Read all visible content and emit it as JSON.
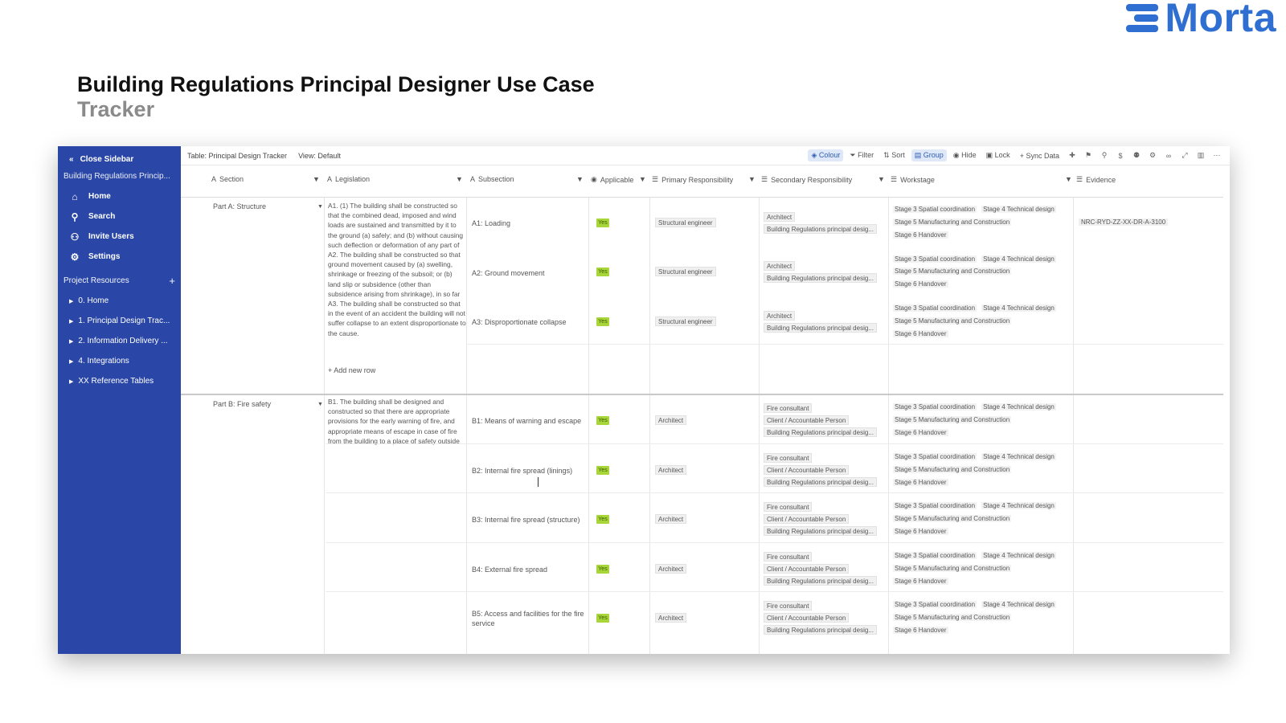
{
  "logo": {
    "text": "Morta",
    "color": "#2f6fd1"
  },
  "title": "Building Regulations Principal Designer Use Case",
  "subtitle": "Tracker",
  "sidebar": {
    "close_label": "Close Sidebar",
    "project_name": "Building Regulations Princip...",
    "nav": [
      {
        "label": "Home",
        "icon": "home-icon"
      },
      {
        "label": "Search",
        "icon": "search-icon"
      },
      {
        "label": "Invite Users",
        "icon": "users-icon"
      },
      {
        "label": "Settings",
        "icon": "gear-icon"
      }
    ],
    "resources_label": "Project Resources",
    "resources": [
      "0. Home",
      "1. Principal Design Trac...",
      "2. Information Delivery ...",
      "4. Integrations",
      "XX Reference Tables"
    ],
    "bg_color": "#2a47a8"
  },
  "toolbar": {
    "table_label": "Table: Principal Design Tracker",
    "view_label": "View: Default",
    "buttons": [
      "Colour",
      "Filter",
      "Sort",
      "Group",
      "Hide",
      "Lock",
      "Sync Data"
    ]
  },
  "columns": [
    "Section",
    "Legislation",
    "Subsection",
    "Applicable",
    "Primary Responsibility",
    "Secondary Responsibility",
    "Workstage",
    "Evidence"
  ],
  "groups": [
    {
      "section": "Part A: Structure",
      "legislation": "A1. (1) The building shall be constructed so that the combined dead, imposed and wind loads are sustained and transmitted by it to the ground (a) safely; and (b) without causing such deflection or deformation of any part of A2. The building shall be constructed so that ground movement caused by (a) swelling, shrinkage or freezing of the subsoil; or (b) land slip or subsidence (other than subsidence arising from shrinkage), in so far A3. The building shall be constructed so that in the event of an accident the building will not suffer collapse to an extent disproportionate to the cause.",
      "add_row": "+ Add new row",
      "rows": [
        {
          "subsection": "A1: Loading",
          "applicable": "Yes",
          "primary": "Structural engineer",
          "secondary": [
            "Architect",
            "Building Regulations principal desig..."
          ],
          "workstage": [
            [
              "Stage 3 Spatial coordination",
              "Stage 4 Technical design"
            ],
            [
              "Stage 5 Manufacturing and Construction"
            ],
            [
              "Stage 6 Handover"
            ]
          ],
          "evidence": "NRC-RYD-ZZ-XX-DR-A-3100"
        },
        {
          "subsection": "A2: Ground movement",
          "applicable": "Yes",
          "primary": "Structural engineer",
          "secondary": [
            "Architect",
            "Building Regulations principal desig..."
          ],
          "workstage": [
            [
              "Stage 3 Spatial coordination",
              "Stage 4 Technical design"
            ],
            [
              "Stage 5 Manufacturing and Construction"
            ],
            [
              "Stage 6 Handover"
            ]
          ],
          "evidence": ""
        },
        {
          "subsection": "A3: Disproportionate collapse",
          "applicable": "Yes",
          "primary": "Structural engineer",
          "secondary": [
            "Architect",
            "Building Regulations principal desig..."
          ],
          "workstage": [
            [
              "Stage 3 Spatial coordination",
              "Stage 4 Technical design"
            ],
            [
              "Stage 5 Manufacturing and Construction"
            ],
            [
              "Stage 6 Handover"
            ]
          ],
          "evidence": ""
        }
      ]
    },
    {
      "section": "Part B: Fire safety",
      "legislation": "B1. The building shall be designed and constructed so that there are appropriate provisions for the early warning of fire, and appropriate means of escape in case of fire from the building to a place of safety outside",
      "rows": [
        {
          "subsection": "B1: Means of warning and escape",
          "applicable": "Yes",
          "primary": "Architect",
          "secondary": [
            "Fire consultant",
            "Client / Accountable Person",
            "Building Regulations principal desig..."
          ],
          "workstage": [
            [
              "Stage 3 Spatial coordination",
              "Stage 4 Technical design"
            ],
            [
              "Stage 5 Manufacturing and Construction"
            ],
            [
              "Stage 6 Handover"
            ]
          ]
        },
        {
          "subsection": "B2: Internal fire spread (linings)",
          "applicable": "Yes",
          "primary": "Architect",
          "secondary": [
            "Fire consultant",
            "Client / Accountable Person",
            "Building Regulations principal desig..."
          ],
          "workstage": [
            [
              "Stage 3 Spatial coordination",
              "Stage 4 Technical design"
            ],
            [
              "Stage 5 Manufacturing and Construction"
            ],
            [
              "Stage 6 Handover"
            ]
          ]
        },
        {
          "subsection": "B3: Internal fire spread (structure)",
          "applicable": "Yes",
          "primary": "Architect",
          "secondary": [
            "Fire consultant",
            "Client / Accountable Person",
            "Building Regulations principal desig..."
          ],
          "workstage": [
            [
              "Stage 3 Spatial coordination",
              "Stage 4 Technical design"
            ],
            [
              "Stage 5 Manufacturing and Construction"
            ],
            [
              "Stage 6 Handover"
            ]
          ]
        },
        {
          "subsection": "B4: External fire spread",
          "applicable": "Yes",
          "primary": "Architect",
          "secondary": [
            "Fire consultant",
            "Client / Accountable Person",
            "Building Regulations principal desig..."
          ],
          "workstage": [
            [
              "Stage 3 Spatial coordination",
              "Stage 4 Technical design"
            ],
            [
              "Stage 5 Manufacturing and Construction"
            ],
            [
              "Stage 6 Handover"
            ]
          ]
        },
        {
          "subsection": "B5: Access and facilities for the fire service",
          "applicable": "Yes",
          "primary": "Architect",
          "secondary": [
            "Fire consultant",
            "Client / Accountable Person",
            "Building Regulations principal desig..."
          ],
          "workstage": [
            [
              "Stage 3 Spatial coordination",
              "Stage 4 Technical design"
            ],
            [
              "Stage 5 Manufacturing and Construction"
            ],
            [
              "Stage 6 Handover"
            ]
          ]
        }
      ]
    }
  ],
  "colors": {
    "yes": "#a8d63a",
    "accent": "#2f5db4"
  }
}
